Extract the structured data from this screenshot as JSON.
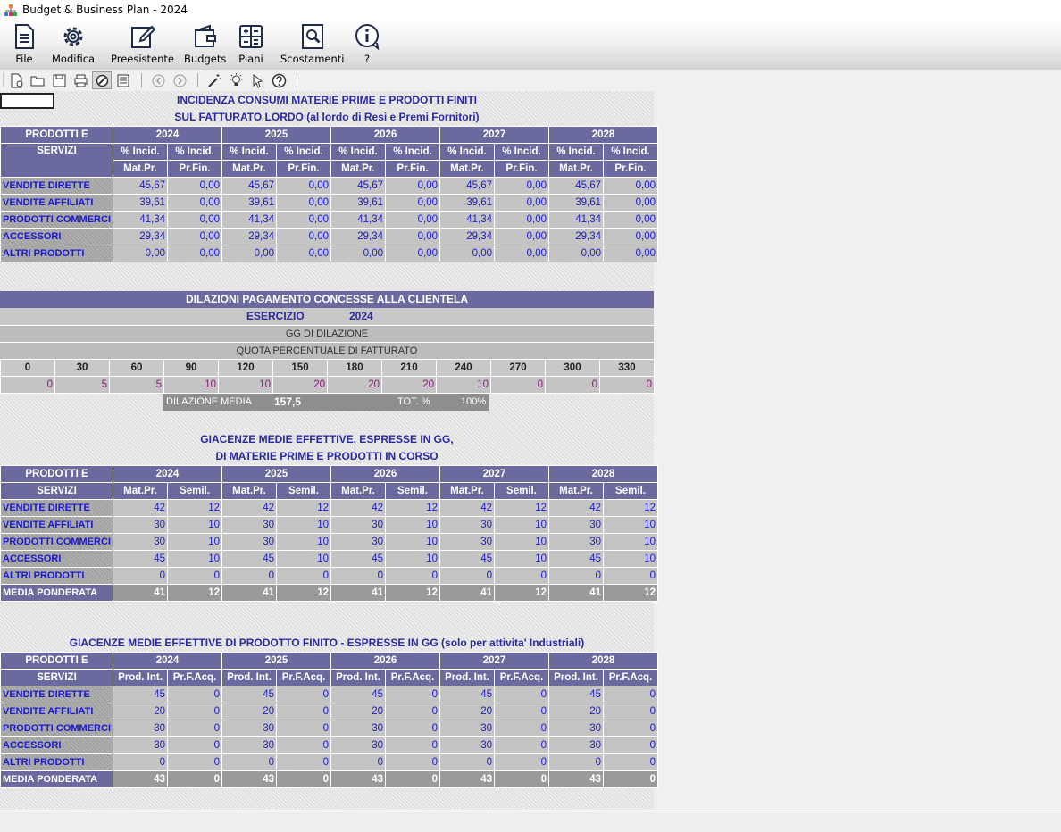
{
  "window": {
    "title": "Budget & Business Plan - 2024"
  },
  "ribbon": {
    "file": "File",
    "modifica": "Modifica",
    "preesistente": "Preesistente",
    "budgets": "Budgets",
    "piani": "Piani",
    "scostamenti": "Scostamenti",
    "help": "?"
  },
  "colors": {
    "header": "#6a6a9e",
    "value_text": "#1a1acc",
    "percent_text": "#8a1a7a",
    "cell": "#c4c4c4"
  },
  "t1": {
    "title1": "INCIDENZA  CONSUMI MATERIE PRIME  E PRODOTTI  FINITI",
    "title2": "SUL FATTURATO LORDO (al lordo di Resi e Premi Fornitori)",
    "hdr_a": "PRODOTTI E",
    "hdr_b": "SERVIZI",
    "years": [
      "2024",
      "2025",
      "2026",
      "2027",
      "2028"
    ],
    "sub1a": "% Incid.",
    "sub1b": "Mat.Pr.",
    "sub2a": "% Incid.",
    "sub2b": "Pr.Fin.",
    "rows": [
      {
        "label": "VENDITE DIRETTE",
        "values": [
          "45,67",
          "0,00",
          "45,67",
          "0,00",
          "45,67",
          "0,00",
          "45,67",
          "0,00",
          "45,67",
          "0,00"
        ]
      },
      {
        "label": "VENDITE AFFILIATI",
        "values": [
          "39,61",
          "0,00",
          "39,61",
          "0,00",
          "39,61",
          "0,00",
          "39,61",
          "0,00",
          "39,61",
          "0,00"
        ]
      },
      {
        "label": "PRODOTTI COMMERCI",
        "values": [
          "41,34",
          "0,00",
          "41,34",
          "0,00",
          "41,34",
          "0,00",
          "41,34",
          "0,00",
          "41,34",
          "0,00"
        ]
      },
      {
        "label": "ACCESSORI",
        "values": [
          "29,34",
          "0,00",
          "29,34",
          "0,00",
          "29,34",
          "0,00",
          "29,34",
          "0,00",
          "29,34",
          "0,00"
        ]
      },
      {
        "label": "ALTRI PRODOTTI",
        "values": [
          "0,00",
          "0,00",
          "0,00",
          "0,00",
          "0,00",
          "0,00",
          "0,00",
          "0,00",
          "0,00",
          "0,00"
        ]
      }
    ]
  },
  "dil": {
    "title": "DILAZIONI  PAGAMENTO  CONCESSE  ALLA  CLIENTELA",
    "esercizio_label": "ESERCIZIO",
    "esercizio_year": "2024",
    "gg_label": "GG  DI  DILAZIONE",
    "quota_label": "QUOTA  PERCENTUALE  DI  FATTURATO",
    "days": [
      "0",
      "30",
      "60",
      "90",
      "120",
      "150",
      "180",
      "210",
      "240",
      "270",
      "300",
      "330"
    ],
    "percents": [
      "0",
      "5",
      "5",
      "10",
      "10",
      "20",
      "20",
      "20",
      "10",
      "0",
      "0",
      "0"
    ],
    "media_label": "DILAZIONE MEDIA",
    "media_value": "157,5",
    "tot_label": "TOT. %",
    "tot_value": "100%"
  },
  "t2": {
    "title1": "GIACENZE MEDIE EFFETTIVE, ESPRESSE IN GG,",
    "title2": "DI MATERIE  PRIME  E  PRODOTTI  IN CORSO",
    "hdr_a": "PRODOTTI E",
    "hdr_b": "SERVIZI",
    "years": [
      "2024",
      "2025",
      "2026",
      "2027",
      "2028"
    ],
    "sub1": "Mat.Pr.",
    "sub2": "Semil.",
    "rows": [
      {
        "label": "VENDITE DIRETTE",
        "values": [
          "42",
          "12",
          "42",
          "12",
          "42",
          "12",
          "42",
          "12",
          "42",
          "12"
        ]
      },
      {
        "label": "VENDITE AFFILIATI",
        "values": [
          "30",
          "10",
          "30",
          "10",
          "30",
          "10",
          "30",
          "10",
          "30",
          "10"
        ]
      },
      {
        "label": "PRODOTTI COMMERCI",
        "values": [
          "30",
          "10",
          "30",
          "10",
          "30",
          "10",
          "30",
          "10",
          "30",
          "10"
        ]
      },
      {
        "label": "ACCESSORI",
        "values": [
          "45",
          "10",
          "45",
          "10",
          "45",
          "10",
          "45",
          "10",
          "45",
          "10"
        ]
      },
      {
        "label": "ALTRI PRODOTTI",
        "values": [
          "0",
          "0",
          "0",
          "0",
          "0",
          "0",
          "0",
          "0",
          "0",
          "0"
        ]
      }
    ],
    "media": {
      "label": "MEDIA PONDERATA",
      "values": [
        "41",
        "12",
        "41",
        "12",
        "41",
        "12",
        "41",
        "12",
        "41",
        "12"
      ]
    }
  },
  "t3": {
    "title": "GIACENZE MEDIE  EFFETTIVE DI PRODOTTO FINITO - ESPRESSE IN GG (solo per attivita' Industriali)",
    "hdr_a": "PRODOTTI E",
    "hdr_b": "SERVIZI",
    "years": [
      "2024",
      "2025",
      "2026",
      "2027",
      "2028"
    ],
    "sub1": "Prod. Int.",
    "sub2": "Pr.F.Acq.",
    "rows": [
      {
        "label": "VENDITE DIRETTE",
        "values": [
          "45",
          "0",
          "45",
          "0",
          "45",
          "0",
          "45",
          "0",
          "45",
          "0"
        ]
      },
      {
        "label": "VENDITE AFFILIATI",
        "values": [
          "20",
          "0",
          "20",
          "0",
          "20",
          "0",
          "20",
          "0",
          "20",
          "0"
        ]
      },
      {
        "label": "PRODOTTI COMMERCI",
        "values": [
          "30",
          "0",
          "30",
          "0",
          "30",
          "0",
          "30",
          "0",
          "30",
          "0"
        ]
      },
      {
        "label": "ACCESSORI",
        "values": [
          "30",
          "0",
          "30",
          "0",
          "30",
          "0",
          "30",
          "0",
          "30",
          "0"
        ]
      },
      {
        "label": "ALTRI PRODOTTI",
        "values": [
          "0",
          "0",
          "0",
          "0",
          "0",
          "0",
          "0",
          "0",
          "0",
          "0"
        ]
      }
    ],
    "media": {
      "label": "MEDIA PONDERATA",
      "values": [
        "43",
        "0",
        "43",
        "0",
        "43",
        "0",
        "43",
        "0",
        "43",
        "0"
      ]
    }
  }
}
